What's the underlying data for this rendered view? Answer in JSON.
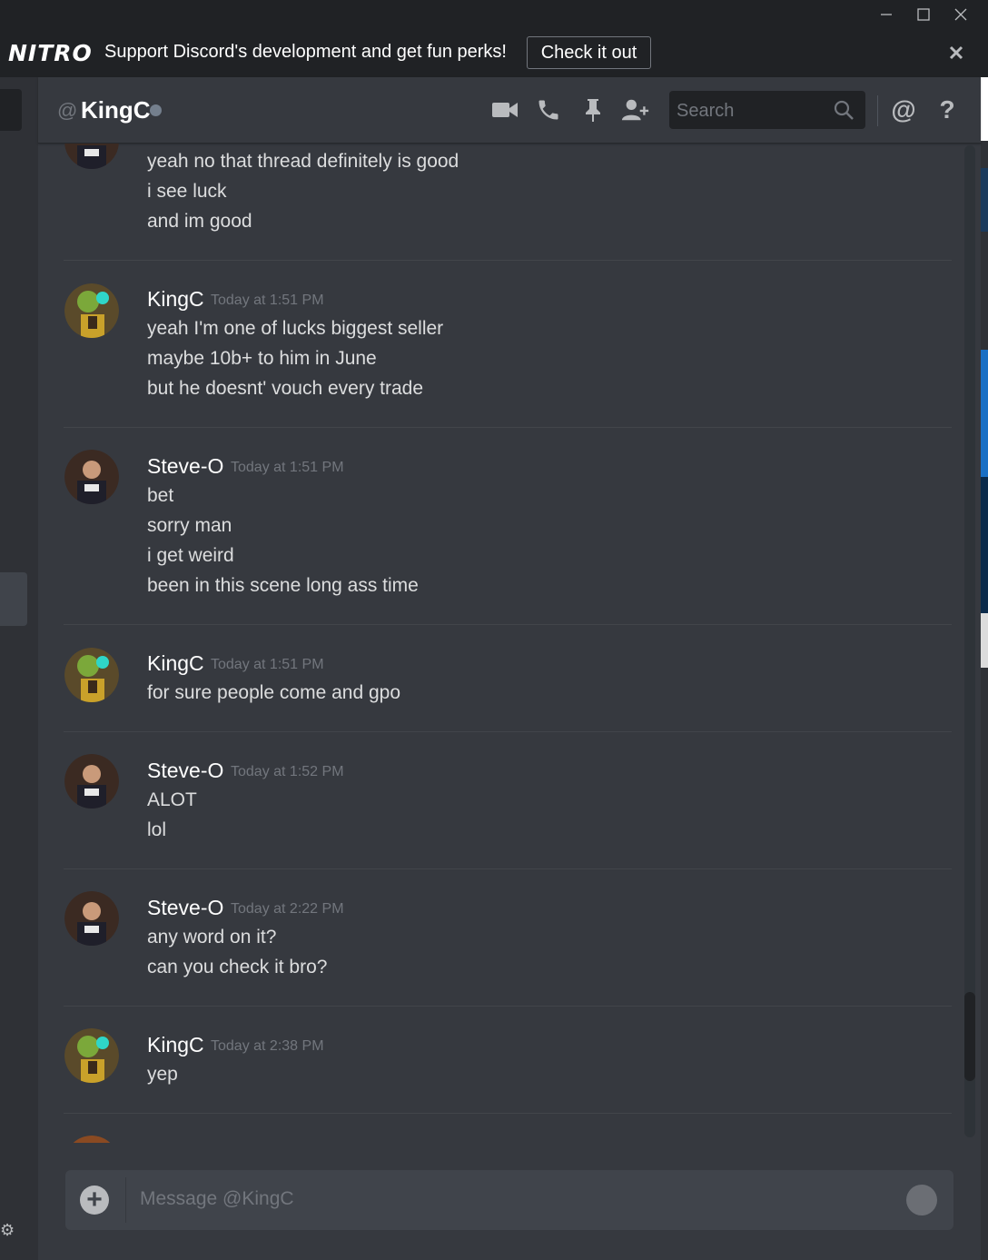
{
  "window": {
    "minimize_label": "–",
    "maximize_label": "☐",
    "close_label": "✕"
  },
  "nitro_banner": {
    "logo": "NITRO",
    "text": "Support Discord's development and get fun perks!",
    "button_label": "Check it out",
    "dismiss_icon": "close-icon"
  },
  "header": {
    "at_symbol": "@",
    "username": "KingC",
    "status": "offline",
    "status_color": "#747f8d",
    "icons": [
      "video-call-icon",
      "voice-call-icon",
      "pin-icon",
      "add-friend-icon",
      "mentions-icon",
      "help-icon"
    ],
    "mention_label": "@",
    "help_label": "?",
    "search_placeholder": "Search"
  },
  "messages": [
    {
      "username": "",
      "timestamp": "",
      "lines": [
        "yeah no that thread definitely is good",
        "i see luck",
        "and im good"
      ]
    },
    {
      "username": "KingC",
      "timestamp": "Today at 1:51 PM",
      "lines": [
        "yeah I'm one of lucks biggest seller",
        "maybe 10b+ to him in June",
        "but he doesnt' vouch every trade"
      ]
    },
    {
      "username": "Steve-O",
      "timestamp": "Today at 1:51 PM",
      "lines": [
        "bet",
        "sorry man",
        "i get weird",
        "been in this scene long ass time"
      ]
    },
    {
      "username": "KingC",
      "timestamp": "Today at 1:51 PM",
      "lines": [
        "for sure people come and gpo"
      ]
    },
    {
      "username": "Steve-O",
      "timestamp": "Today at 1:52 PM",
      "lines": [
        "ALOT",
        "lol"
      ]
    },
    {
      "username": "Steve-O",
      "timestamp": "Today at 2:22 PM",
      "lines": [
        "any word on it?",
        "can you check it bro?"
      ]
    },
    {
      "username": "KingC",
      "timestamp": "Today at 2:38 PM",
      "lines": [
        "yep"
      ]
    }
  ],
  "composer": {
    "placeholder": "Message @KingC",
    "attach_label": "+"
  },
  "colors": {
    "background": "#36393f",
    "banner": "#202225",
    "text": "#dcddde",
    "muted": "#72767d"
  }
}
